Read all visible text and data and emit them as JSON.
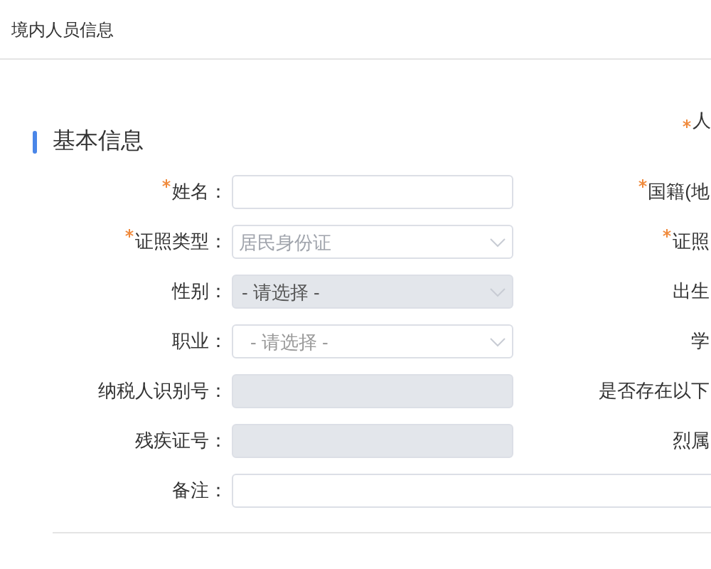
{
  "header": {
    "title": "境内人员信息"
  },
  "top_right_label": {
    "required": true,
    "text": "人"
  },
  "section": {
    "title": "基本信息"
  },
  "rows": [
    {
      "label": "姓名：",
      "required": true,
      "field": {
        "kind": "text",
        "disabled": false
      },
      "right_label": {
        "required": true,
        "text": "国籍(地"
      }
    },
    {
      "label": "证照类型：",
      "required": true,
      "field": {
        "kind": "select",
        "disabled": false,
        "value": "居民身份证"
      },
      "right_label": {
        "required": true,
        "text": "证照"
      }
    },
    {
      "label": "性别：",
      "required": false,
      "field": {
        "kind": "select",
        "disabled": true,
        "placeholder": "- 请选择 -"
      },
      "right_label": {
        "required": false,
        "text": "出生"
      }
    },
    {
      "label": "职业：",
      "required": false,
      "field": {
        "kind": "select",
        "disabled": false,
        "placeholder": "- 请选择 -"
      },
      "right_label": {
        "required": false,
        "text": "学"
      }
    },
    {
      "label": "纳税人识别号：",
      "required": false,
      "field": {
        "kind": "text",
        "disabled": true
      },
      "right_label": {
        "required": false,
        "text": "是否存在以下"
      }
    },
    {
      "label": "残疾证号：",
      "required": false,
      "field": {
        "kind": "text",
        "disabled": true
      },
      "right_label": {
        "required": false,
        "text": "烈属"
      }
    },
    {
      "label": "备注：",
      "required": false,
      "field": {
        "kind": "wide",
        "disabled": false
      }
    }
  ]
}
